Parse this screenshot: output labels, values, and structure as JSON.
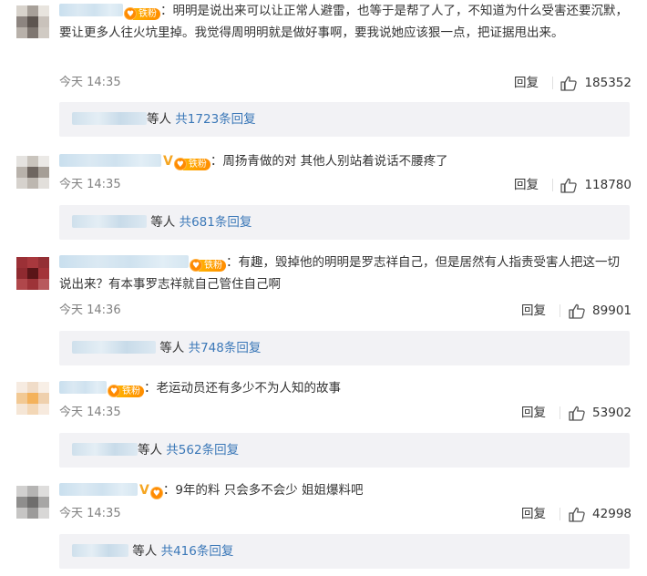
{
  "comments": [
    {
      "fan_label": "铁粉",
      "text": "明明是说出来可以让正常人避雷，也等于是帮了人了，不知道为什么受害还要沉默，要让更多人往火坑里掉。我觉得周明明就是做好事啊，要我说她应该狠一点，把证据甩出来。",
      "time": "今天 14:35",
      "reply_label": "回复",
      "likes": "185352",
      "replies_suffix": "等人",
      "replies_count": "共1723条回复",
      "avatar_colors": [
        "#d8d3cc",
        "#a7a099",
        "#e8e4de",
        "#8d8580",
        "#5d5550",
        "#c9c2bb",
        "#b8b1aa",
        "#7e7670",
        "#d0cac3"
      ]
    },
    {
      "fan_label": "铁粉",
      "text": "周扬青做的对 其他人别站着说话不腰疼了",
      "time": "今天 14:35",
      "reply_label": "回复",
      "likes": "118780",
      "replies_suffix": "等人",
      "replies_count": "共681条回复",
      "avatar_colors": [
        "#e5e3e0",
        "#c9c4bd",
        "#ebe9e6",
        "#b8b2ab",
        "#6e6660",
        "#a59e96",
        "#d6d2cd",
        "#bdb7b0",
        "#e2dfdb"
      ]
    },
    {
      "fan_label": "铁粉",
      "text": "有趣，毁掉他的明明是罗志祥自己，但是居然有人指责受害人把这一切说出来？有本事罗志祥就自己管住自己啊",
      "time": "今天 14:36",
      "reply_label": "回复",
      "likes": "89901",
      "replies_suffix": "等人",
      "replies_count": "共748条回复",
      "avatar_colors": [
        "#9b3036",
        "#a8383d",
        "#943035",
        "#8f2a30",
        "#5a1518",
        "#a33439",
        "#b0474b",
        "#9d3338",
        "#b85a5d"
      ]
    },
    {
      "fan_label": "铁粉",
      "text": "老运动员还有多少不为人知的故事",
      "time": "今天 14:35",
      "reply_label": "回复",
      "likes": "53902",
      "replies_suffix": "等人",
      "replies_count": "共562条回复",
      "avatar_colors": [
        "#f6ebe1",
        "#f0dcc8",
        "#f8efe6",
        "#f2c994",
        "#f4b25b",
        "#efd0ad",
        "#f5e6d6",
        "#f3d7b6",
        "#f7eade"
      ]
    },
    {
      "fan_label": "",
      "text": "9年的料 只会多不会少  姐姐爆料吧",
      "time": "今天 14:35",
      "reply_label": "回复",
      "likes": "42998",
      "replies_suffix": "等人",
      "replies_count": "共416条回复",
      "avatar_colors": [
        "#d1d0cf",
        "#b5b4b3",
        "#dedddc",
        "#8f8e8d",
        "#6f6e6d",
        "#a7a6a5",
        "#c6c5c4",
        "#9c9b9a",
        "#d8d7d6"
      ]
    }
  ],
  "colors": {
    "link": "#3b78b8",
    "meta_gray": "#808080",
    "reply_bg": "#f2f2f5",
    "fan_orange": "#ff8c00",
    "v_badge": "#f5a623"
  },
  "icons": {
    "like": "thumbs-up-icon",
    "verified": "v-badge-icon",
    "fan": "fan-heart-icon"
  }
}
